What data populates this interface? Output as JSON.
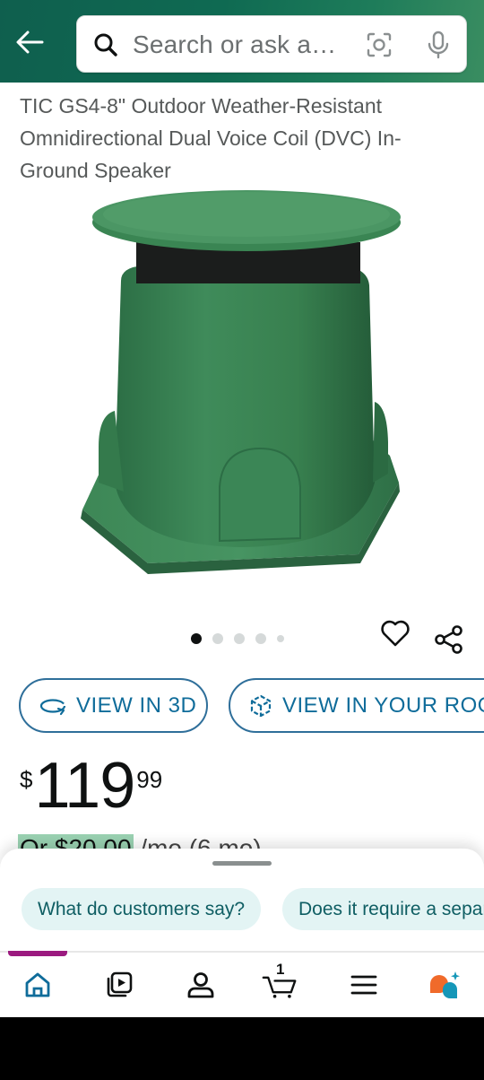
{
  "header": {
    "search_placeholder": "Search or ask a…"
  },
  "product": {
    "title": "TIC GS4-8\" Outdoor Weather-Resistant Omnidirectional Dual Voice Coil (DVC) In-Ground Speaker",
    "image_count": 5,
    "active_image_index": 0
  },
  "actions": {
    "view_3d_label": "VIEW IN 3D",
    "view_room_label": "VIEW IN YOUR ROOM"
  },
  "price": {
    "symbol": "$",
    "whole": "119",
    "fraction": "99"
  },
  "installment": {
    "prefix": "Or ",
    "amount": "$20.00",
    "suffix": " /mo (6 mo)"
  },
  "suggestions": [
    {
      "label": "What do customers say?"
    },
    {
      "label": "Does it require a separate amplifier?"
    }
  ],
  "nav": {
    "cart_count": "1"
  },
  "colors": {
    "header_green": "#0f6a52",
    "link_blue": "#0f6c9a",
    "chip_bg": "#e3f4f4",
    "active_nav": "#0f6c9a"
  }
}
